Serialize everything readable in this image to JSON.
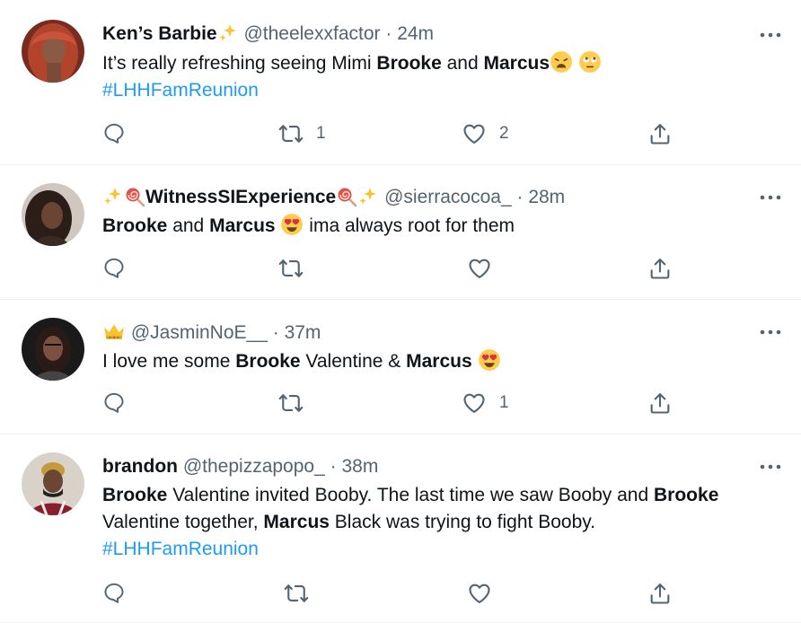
{
  "tweets": [
    {
      "name": "Ken’s Barbie",
      "handle": "@theelexxfactor",
      "time": "24m",
      "text": {
        "t1": "It’s really refreshing seeing Mimi ",
        "b1": "Brooke",
        "t2": " and ",
        "b2": "Marcus"
      },
      "hashtag": "#LHHFamReunion",
      "retweets": "1",
      "likes": "2"
    },
    {
      "name": "WitnessSIExperience",
      "handle": "@sierracocoa_",
      "time": "28m",
      "text": {
        "b1": "Brooke",
        "t1": " and ",
        "b2": "Marcus",
        "t2": " ima always root for them"
      },
      "retweets": "",
      "likes": ""
    },
    {
      "name": "",
      "handle": "@JasminNoE__",
      "time": "37m",
      "text": {
        "t1": "I love me some ",
        "b1": "Brooke",
        "t2": " Valentine & ",
        "b2": "Marcus"
      },
      "retweets": "",
      "likes": "1"
    },
    {
      "name": "brandon",
      "handle": "@thepizzapopo_",
      "time": "38m",
      "text": {
        "b1": "Brooke",
        "t1": " Valentine invited Booby. The last time we saw Booby and ",
        "b2": "Brooke",
        "t2": "Valentine together, ",
        "b3": "Marcus",
        "t3": " Black was trying to fight Booby."
      },
      "hashtag": "#LHHFamReunion",
      "retweets": "",
      "likes": ""
    }
  ],
  "separator": "·",
  "icons": [
    "reply-icon",
    "retweet-icon",
    "like-icon",
    "share-icon",
    "more-icon"
  ],
  "colors": {
    "link": "#1d9bf0",
    "muted": "#536471",
    "text": "#0f1419",
    "border": "#eff3f4"
  }
}
